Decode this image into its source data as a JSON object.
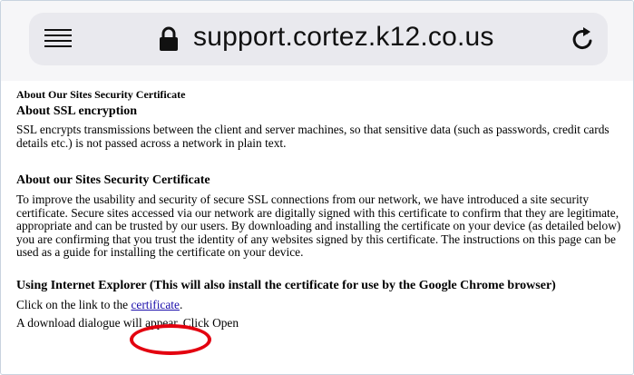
{
  "browser": {
    "url": "support.cortez.k12.co.us",
    "icons": [
      "menu-icon",
      "lock-icon",
      "reload-icon"
    ]
  },
  "page": {
    "small_title": "About Our Sites Security Certificate",
    "section1": {
      "heading": "About SSL encryption",
      "text": "SSL encrypts transmissions between the client and server machines, so that sensitive data (such as passwords, credit cards details etc.) is not passed across a network in plain text."
    },
    "section2": {
      "heading": "About our Sites Security Certificate",
      "text": "To improve the usability and security of secure SSL connections from our network, we have introduced a site security certificate. Secure sites accessed via our network are digitally signed with this certificate to confirm that they are legitimate, appropriate and can be trusted by our users. By downloading and installing the certificate on your device (as detailed below) you are confirming that you trust the identity of any websites signed by this certificate. The instructions on this page can be used as a guide for installing the certificate on your device."
    },
    "section3": {
      "heading": "Using Internet Explorer (This will also install the certificate for use by the Google Chrome browser)",
      "link_prefix": "Click on the link to the ",
      "link_text": "certificate",
      "link_suffix": ".",
      "next_line": "A download dialogue will appear. Click Open"
    }
  },
  "annotation": {
    "highlight_color": "#e3000f"
  }
}
